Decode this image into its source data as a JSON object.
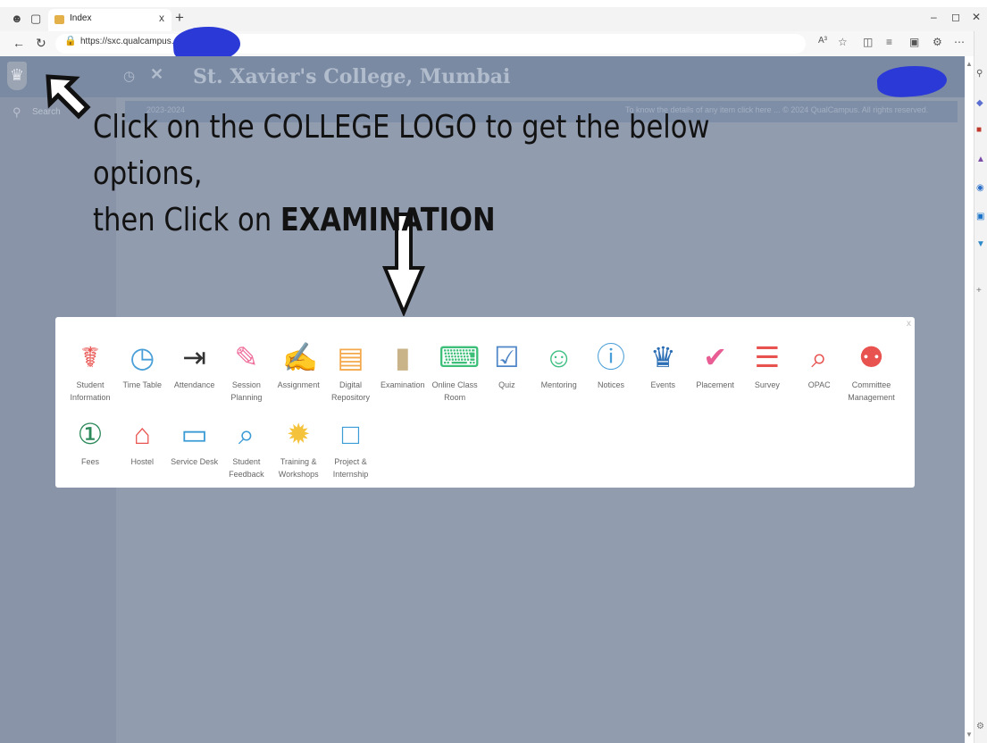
{
  "browser": {
    "tab_title": "Index",
    "tab_close": "x",
    "new_tab": "+",
    "url": "https://sxc.qualcampus.com/",
    "reader_label": "A³"
  },
  "page": {
    "college_name": "St. Xavier's College, Mumbai",
    "search_text": "Search",
    "info_left": "2023-2024",
    "info_right": "To know the details of any item click here ...  © 2024 QualCampus. All rights reserved."
  },
  "instruction": {
    "line1": "Click on the COLLEGE LOGO to get the below options,",
    "line2_prefix": "then Click on ",
    "line2_bold": "EXAMINATION",
    "arrow_down": "⇩",
    "arrow_logo": "⇖"
  },
  "modal": {
    "close": "x",
    "row1": [
      {
        "label": "Student Information",
        "color": "#e8534f",
        "glyph": "☤",
        "icon": "person-icon"
      },
      {
        "label": "Time Table",
        "color": "#4a9fd8",
        "glyph": "◷",
        "icon": "clock-icon"
      },
      {
        "label": "Attendance",
        "color": "#333333",
        "glyph": "⇥",
        "icon": "enter-icon"
      },
      {
        "label": "Session Planning",
        "color": "#ef6f9c",
        "glyph": "✎",
        "icon": "pen-icon"
      },
      {
        "label": "Assignment",
        "color": "#a47bd0",
        "glyph": "✍",
        "icon": "edit-icon"
      },
      {
        "label": "Digital Repository",
        "color": "#f4a84b",
        "glyph": "▤",
        "icon": "document-icon"
      },
      {
        "label": "Examination",
        "color": "#c9b48a",
        "glyph": "▮",
        "icon": "clipboard-icon"
      },
      {
        "label": "Online Class Room",
        "color": "#3dbf7a",
        "glyph": "⌨",
        "icon": "keyboard-icon"
      },
      {
        "label": "Quiz",
        "color": "#4f86c7",
        "glyph": "☑",
        "icon": "checkbox-icon"
      },
      {
        "label": "Mentoring",
        "color": "#3fbf83",
        "glyph": "☺",
        "icon": "users-icon"
      },
      {
        "label": "Notices",
        "color": "#4a9fd8",
        "glyph": "ⓘ",
        "icon": "alert-icon"
      },
      {
        "label": "Events",
        "color": "#2c6fb5",
        "glyph": "♛",
        "icon": "trophy-icon"
      },
      {
        "label": "Placement",
        "color": "#e85d93",
        "glyph": "✔",
        "icon": "clipboard-check-icon"
      },
      {
        "label": "Survey",
        "color": "#e8534f",
        "glyph": "☰",
        "icon": "sliders-icon"
      },
      {
        "label": "OPAC",
        "color": "#e8534f",
        "glyph": "⌕",
        "icon": "search-icon"
      },
      {
        "label": "Committee Management",
        "color": "#e8534f",
        "glyph": "⚉",
        "icon": "group-icon"
      }
    ],
    "row2": [
      {
        "label": "Fees",
        "color": "#2c8a5a",
        "glyph": "①",
        "icon": "money-icon"
      },
      {
        "label": "Hostel",
        "color": "#e8534f",
        "glyph": "⌂",
        "icon": "home-icon"
      },
      {
        "label": "Service Desk",
        "color": "#3a9bd5",
        "glyph": "▭",
        "icon": "monitor-icon"
      },
      {
        "label": "Student Feedback",
        "color": "#3a9bd5",
        "glyph": "⌕",
        "icon": "search-icon"
      },
      {
        "label": "Training & Workshops",
        "color": "#f5c33b",
        "glyph": "✹",
        "icon": "star-badge-icon"
      },
      {
        "label": "Project & Internship",
        "color": "#3a9bd5",
        "glyph": "□",
        "icon": "laptop-icon"
      }
    ]
  }
}
